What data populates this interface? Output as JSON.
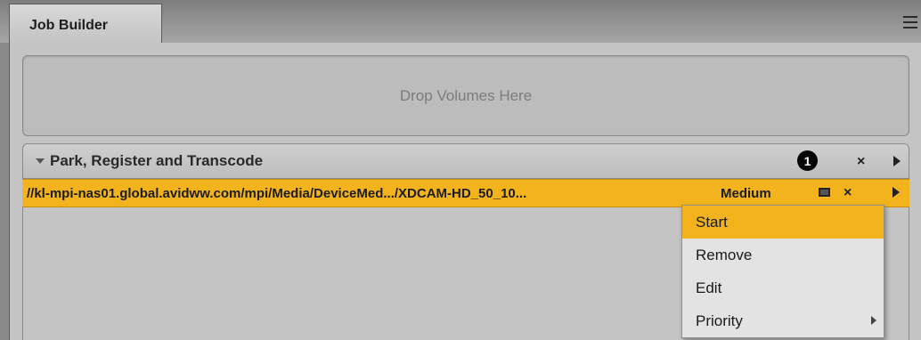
{
  "panel": {
    "tab_label": "Job Builder",
    "menu_icon": "hamburger-menu-icon"
  },
  "dropzone": {
    "text": "Drop Volumes Here"
  },
  "job_group": {
    "title": "Park, Register and Transcode",
    "count": "1",
    "remove_symbol": "×",
    "expand_icon": "triangle-down-icon",
    "play_icon": "play-icon"
  },
  "job_row": {
    "path": "//kl-mpi-nas01.global.avidww.com/mpi/Media/DeviceMed.../XDCAM-HD_50_10...",
    "priority": "Medium",
    "remove_symbol": "×",
    "monitor_icon": "monitor-icon",
    "play_icon": "play-icon",
    "highlight_color": "#f2b31c"
  },
  "context_menu": {
    "items": [
      {
        "label": "Start",
        "active": true
      },
      {
        "label": "Remove"
      },
      {
        "label": "Edit"
      },
      {
        "label": "Priority",
        "submenu": true
      }
    ]
  }
}
